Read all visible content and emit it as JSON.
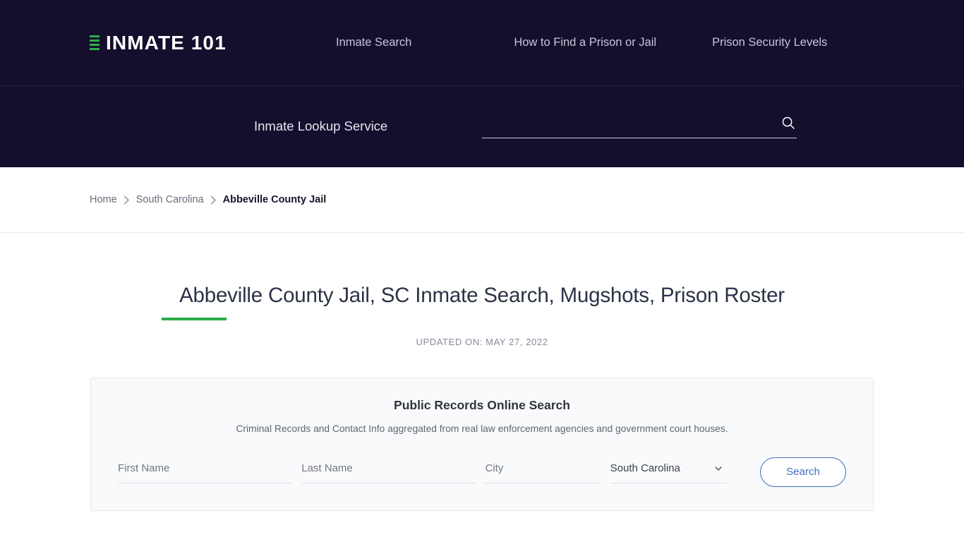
{
  "header": {
    "brand": {
      "name": "INMATE 101",
      "mark_color": "#2bae4a"
    },
    "nav": [
      {
        "label": "Inmate Search"
      },
      {
        "label": "How to Find a Prison or Jail"
      },
      {
        "label": "Prison Security Levels"
      }
    ],
    "lookup_label": "Inmate Lookup Service",
    "search": {
      "value": "",
      "placeholder": "",
      "icon": "search-icon"
    },
    "background_color": "#150e2d"
  },
  "breadcrumb": {
    "items": [
      {
        "label": "Home",
        "current": false
      },
      {
        "label": "South Carolina",
        "current": false
      },
      {
        "label": "Abbeville County Jail",
        "current": true
      }
    ],
    "separator_icon": "chevron-right-icon"
  },
  "main": {
    "title": "Abbeville County Jail, SC Inmate Search, Mugshots, Prison Roster",
    "title_accent_color": "#2bae4a",
    "updated_on": "UPDATED ON: MAY 27, 2022"
  },
  "records_card": {
    "title": "Public Records Online Search",
    "subtitle": "Criminal Records and Contact Info aggregated from real law enforcement agencies and government court houses.",
    "form": {
      "first_name": {
        "value": "",
        "placeholder": "First Name"
      },
      "last_name": {
        "value": "",
        "placeholder": "Last Name"
      },
      "city": {
        "value": "",
        "placeholder": "City"
      },
      "state": {
        "selected": "South Carolina",
        "chevron_icon": "chevron-down-icon"
      },
      "submit_label": "Search",
      "submit_border_color": "#3a6fc4"
    }
  }
}
